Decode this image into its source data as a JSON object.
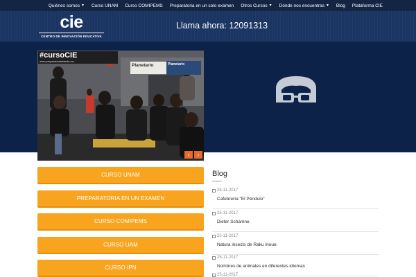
{
  "nav": {
    "items": [
      {
        "label": "Quiénes somos",
        "caret": true
      },
      {
        "label": "Curso UNAM",
        "caret": false
      },
      {
        "label": "Curso COMIPEMS",
        "caret": false
      },
      {
        "label": "Preparatoria en un solo examen",
        "caret": false
      },
      {
        "label": "Otros Cursos",
        "caret": true
      },
      {
        "label": "Dónde nos encuentras",
        "caret": true
      },
      {
        "label": "Blog",
        "caret": false
      },
      {
        "label": "Plataforma CIE",
        "caret": false
      }
    ]
  },
  "header": {
    "logo_mark": "cie",
    "logo_tagline": "CENTRO DE INNOVACIÓN EDUCATIVA",
    "phone": "Llama ahora: 12091313"
  },
  "slider": {
    "tag": "#cursoCIE",
    "tag_url": "www.preparatoriaabierta.mx",
    "sign_right": "Planetario",
    "sign_center": "Planetario",
    "prev_icon": "‹",
    "next_icon": "›"
  },
  "buttons": [
    "CURSO UNAM",
    "PREPARATORIA EN UN EXAMEN",
    "CURSO COMIPEMS",
    "CURSO UAM",
    "CURSO IPN"
  ],
  "blog": {
    "title": "Blog",
    "posts": [
      {
        "date": "25-11-2017",
        "title": "Cafebrería \"El Péndulo\""
      },
      {
        "date": "25-11-2017",
        "title": "Dieter Schamne"
      },
      {
        "date": "25-11-2017",
        "title": "Natura insects de Raku Inoue."
      },
      {
        "date": "25-11-2017",
        "title": "Nombres de animales en diferentes idiomas"
      },
      {
        "date": "25-11-2017",
        "title": ""
      }
    ]
  },
  "colors": {
    "nav_bg": "#142544",
    "header_bg": "#1b3563",
    "hero_bg": "#0d2248",
    "button_orange": "#f9a41e",
    "slider_arrow": "#e86a2b"
  }
}
